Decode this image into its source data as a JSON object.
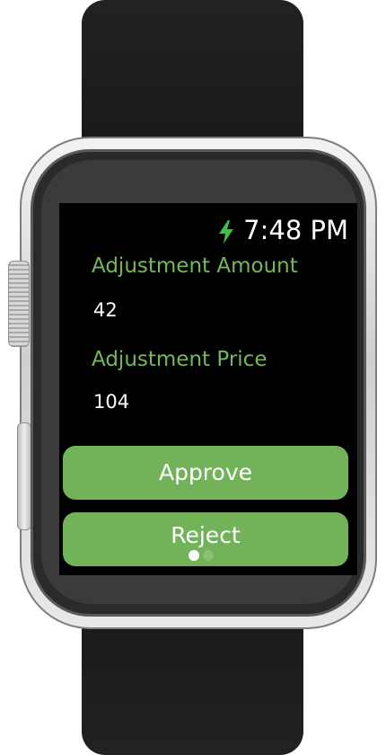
{
  "status": {
    "time": "7:48 PM",
    "charging_icon": "lightning-bolt-icon",
    "icon_color": "#3fbf4a"
  },
  "fields": [
    {
      "label": "Adjustment Amount",
      "value": "42"
    },
    {
      "label": "Adjustment Price",
      "value": "104"
    }
  ],
  "actions": {
    "approve_label": "Approve",
    "reject_label": "Reject"
  },
  "pager": {
    "page_count": 2,
    "current_page": 1
  },
  "colors": {
    "accent_green": "#72b359",
    "label_green": "#74b85a",
    "screen_background": "#000000"
  }
}
